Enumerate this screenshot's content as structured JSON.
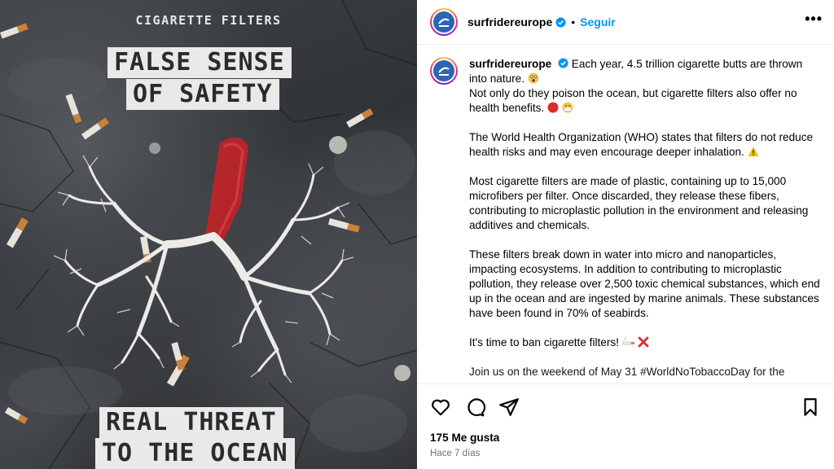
{
  "poster": {
    "kicker": "CIGARETTE FILTERS",
    "headline_line1": "FALSE SENSE",
    "headline_line2": "OF SAFETY",
    "footer_line1": "REAL THREAT",
    "footer_line2": "TO THE OCEAN"
  },
  "header": {
    "username": "surfridereurope",
    "separator": "•",
    "follow_label": "Seguir",
    "more_label": "•••"
  },
  "caption": {
    "username": "surfridereurope",
    "p1_text": "Each year, 4.5 trillion cigarette butts are thrown into nature.",
    "p1_line2": "Not only do they poison the ocean, but cigarette filters also offer no health benefits.",
    "p2": "The World Health Organization (WHO) states that filters do not reduce health risks and may even encourage deeper inhalation.",
    "p3": "Most cigarette filters are made of plastic, containing up to 15,000 microfibers per filter. Once discarded, they release these fibers, contributing to microplastic pollution in the environment and releasing additives and chemicals.",
    "p4": "These filters break down in water into micro and nanoparticles, impacting ecosystems. In addition to contributing to microplastic pollution, they release over 2,500 toxic chemical substances, which end up in the ocean and are ingested by marine animals. These substances have been found in 70% of seabirds.",
    "p5": "It's time to ban cigarette filters!",
    "p6_cut": "Join us on the weekend of May 31 #WorldNoTobaccoDay for the"
  },
  "footer": {
    "likes": "175 Me gusta",
    "time": "Hace 7 días"
  },
  "colors": {
    "accent": "#0095f6",
    "verified": "#0095f6",
    "timestamp": "#737373",
    "brand_logo": "#2d64b3"
  }
}
